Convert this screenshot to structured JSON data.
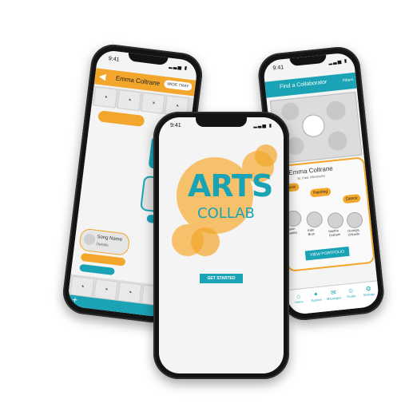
{
  "colors": {
    "accent": "#1aa3b4",
    "accent_orange": "#f2a62b",
    "light_orange": "#f6c16a"
  },
  "left_phone": {
    "time": "9:41",
    "title": "Emma Coltrane",
    "header_button": "WIDE TRAY",
    "song_name": "Song Name",
    "song_details": "Details"
  },
  "center_phone": {
    "time": "9:41",
    "logo_line1": "ARTS",
    "logo_line2": "COLLAB",
    "cta": "GET STARTED"
  },
  "right_phone": {
    "time": "9:41",
    "title": "Find a Collaborator",
    "filter_button": "Filters",
    "profile_name": "Emma Coltrane",
    "profile_location": "St. Paul, Minnesota",
    "tags": [
      "Music",
      "Painting",
      "Dance"
    ],
    "people": [
      {
        "first": "Jason",
        "last": "Mattiso"
      },
      {
        "first": "Kate",
        "last": "Brun"
      },
      {
        "first": "Martha",
        "last": "Graham"
      },
      {
        "first": "Georgia",
        "last": "O'Keefe"
      }
    ],
    "portfolio_button": "VIEW PORTFOLIO",
    "bottom_tabs": [
      "Home",
      "Explore",
      "Messages",
      "Profile",
      "Settings"
    ]
  }
}
